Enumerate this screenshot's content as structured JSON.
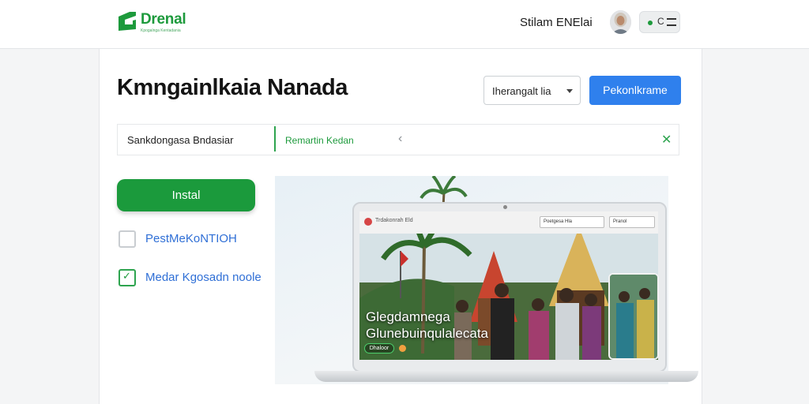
{
  "header": {
    "logo_name": "Drenal",
    "logo_tagline": "Kpogalnga Kentadania",
    "user_name": "Stilam ENElai",
    "toggle_label": "C"
  },
  "page": {
    "title": "Kmngainlkaia Nanada",
    "select_value": "Iherangalt lia",
    "primary_button": "Pekonlkrame"
  },
  "tabs": {
    "tab1": "Sankdongasa Bndasiar",
    "tab2": "Remartin Kedan",
    "back_glyph": "‹",
    "close_glyph": "✕"
  },
  "controls": {
    "install_button": "Instal",
    "option1": {
      "label": "PestMeKoNTIOH",
      "checked": false
    },
    "option2": {
      "label": "Medar Kgosadn noole",
      "checked": true
    }
  },
  "preview": {
    "screen_title": "Trdakonrah Eld",
    "screen_field1": "Poetgesa Hla",
    "screen_field2": "Pranol",
    "overlay_line1": "Glegdamnega",
    "overlay_line2": "Glunebuinqulalecata",
    "overlay_chip": "Dhaloor"
  },
  "colors": {
    "brand_green": "#1d9a3c",
    "primary_blue": "#2f80ed",
    "link_blue": "#2f6fd6"
  }
}
